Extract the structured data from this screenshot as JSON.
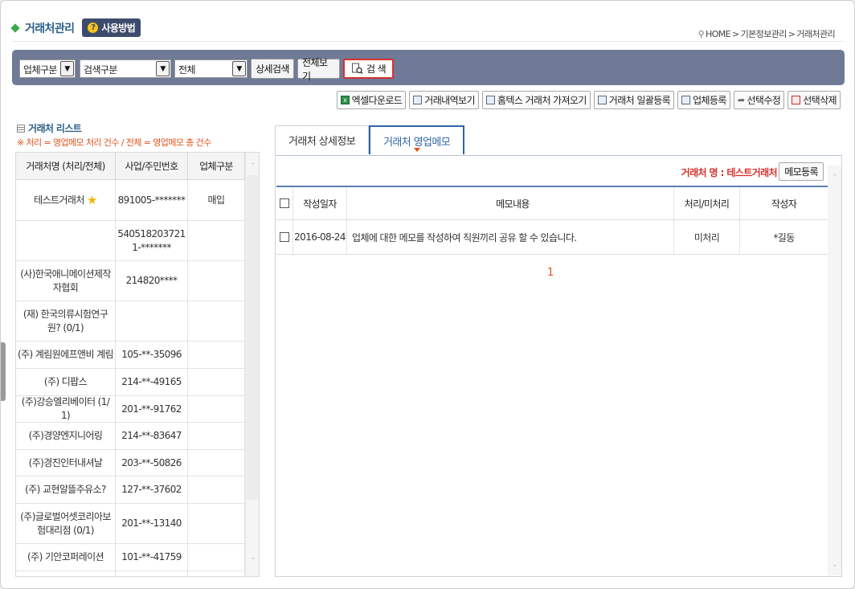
{
  "header": {
    "title": "거래처관리",
    "help_label": "사용방법",
    "breadcrumb": [
      "HOME",
      "기본정보관리",
      "거래처관리"
    ]
  },
  "search": {
    "type_select": "업체구분",
    "field_select": "검색구분",
    "scope_select": "전체",
    "detail_button": "상세검색",
    "view_all_button": "전체보기",
    "search_button": "검 색"
  },
  "toolbar": {
    "excel": "엑셀다운로드",
    "history": "거래내역보기",
    "hometax": "홈텍스 거래처 가져오기",
    "bulk_register": "거래처 일괄등록",
    "register": "업체등록",
    "edit": "선택수정",
    "delete": "선택삭제"
  },
  "left": {
    "title": "거래처 리스트",
    "note_prefix": "※ 처리",
    "note_mid1": " = 영업메모 처리 건수 / ",
    "note_all": "전체",
    "note_mid2": " = 영업메모 총 건수",
    "columns": [
      "거래처명 (처리/전체)",
      "사업/주민번호",
      "업체구분"
    ],
    "rows": [
      {
        "name": "테스트거래처",
        "star": true,
        "no": "891005-*******",
        "type": "매입"
      },
      {
        "name": "",
        "star": false,
        "no": "5405182037211-*******",
        "type": ""
      },
      {
        "name": "(사)한국애니메이션제작자협회",
        "star": false,
        "no": "214820****",
        "type": ""
      },
      {
        "name": "(재) 한국의류시험연구원? (0/1)",
        "star": false,
        "no": "",
        "type": ""
      },
      {
        "name": "(주) 계림원에프앤비 계림",
        "star": false,
        "no": "105-**-35096",
        "type": ""
      },
      {
        "name": "(주) 디팝스",
        "star": false,
        "no": "214-**-49165",
        "type": ""
      },
      {
        "name": "(주)강승엘리베이터 (1/1)",
        "star": false,
        "no": "201-**-91762",
        "type": ""
      },
      {
        "name": "(주)경양엔지니어링",
        "star": false,
        "no": "214-**-83647",
        "type": ""
      },
      {
        "name": "(주)경진인터내셔날",
        "star": false,
        "no": "203-**-50826",
        "type": ""
      },
      {
        "name": "(주) 교현알뜰주유소?",
        "star": false,
        "no": "127-**-37602",
        "type": ""
      },
      {
        "name": "(주)글로벌어셋코리아보험대리점 (0/1)",
        "star": false,
        "no": "201-**-13140",
        "type": ""
      },
      {
        "name": "(주) 기안코퍼레이션",
        "star": false,
        "no": "101-**-41759",
        "type": ""
      }
    ]
  },
  "right": {
    "tabs": [
      "거래처 상세정보",
      "거래처 영업메모"
    ],
    "customer_label": "거래처 명 : 테스트거래처",
    "memo_register": "메모등록",
    "columns": [
      "작성일자",
      "메모내용",
      "처리/미처리",
      "작성자"
    ],
    "rows": [
      {
        "date": "2016-08-24",
        "content": "업체에 대한 메모를 작성하여 직원끼리 공유 할 수 있습니다.",
        "status": "미처리",
        "author": "*길동"
      }
    ],
    "page": "1"
  }
}
